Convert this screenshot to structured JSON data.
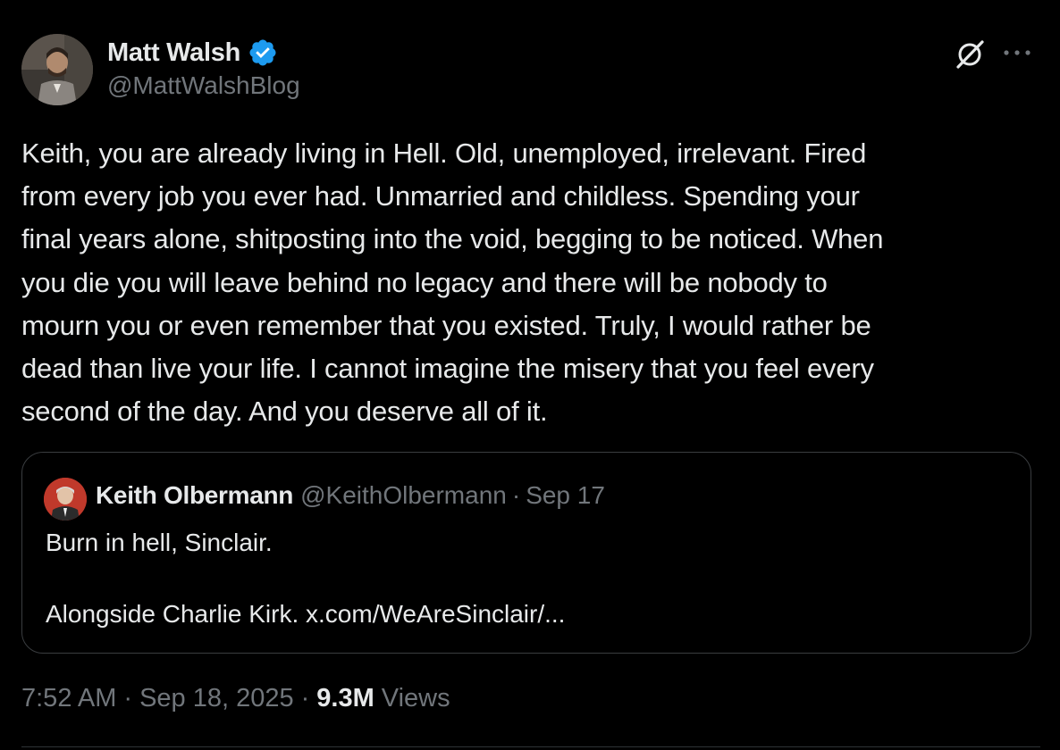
{
  "author": {
    "display_name": "Matt Walsh",
    "handle": "@MattWalshBlog",
    "verified": true,
    "verified_color": "#1d9bf0"
  },
  "post": {
    "text": "Keith, you are already living in Hell. Old, unemployed, irrelevant. Fired\nfrom every job you ever had. Unmarried and childless. Spending your\nfinal years alone, shitposting into the void, begging to be noticed. When\nyou die you will leave behind no legacy and there will be nobody to\nmourn you or even remember that you existed. Truly, I would rather be\ndead than live your life. I cannot imagine the misery that you feel every\nsecond of the day. And you deserve all of it."
  },
  "quote": {
    "display_name": "Keith Olbermann",
    "handle": "@KeithOlbermann",
    "separator": "·",
    "date": "Sep 17",
    "line1": "Burn in hell, Sinclair.",
    "line2": "Alongside Charlie Kirk. x.com/WeAreSinclair/..."
  },
  "meta": {
    "time": "7:52 AM",
    "separator": "·",
    "date": "Sep 18, 2025",
    "views_count": "9.3M",
    "views_label": "Views"
  },
  "icons": {
    "grok": "grok-icon",
    "more": "more-icon",
    "verified": "verified-badge-icon"
  },
  "colors": {
    "background": "#000000",
    "text": "#e7e9ea",
    "secondary": "#71767b",
    "border": "#3a3d40"
  }
}
